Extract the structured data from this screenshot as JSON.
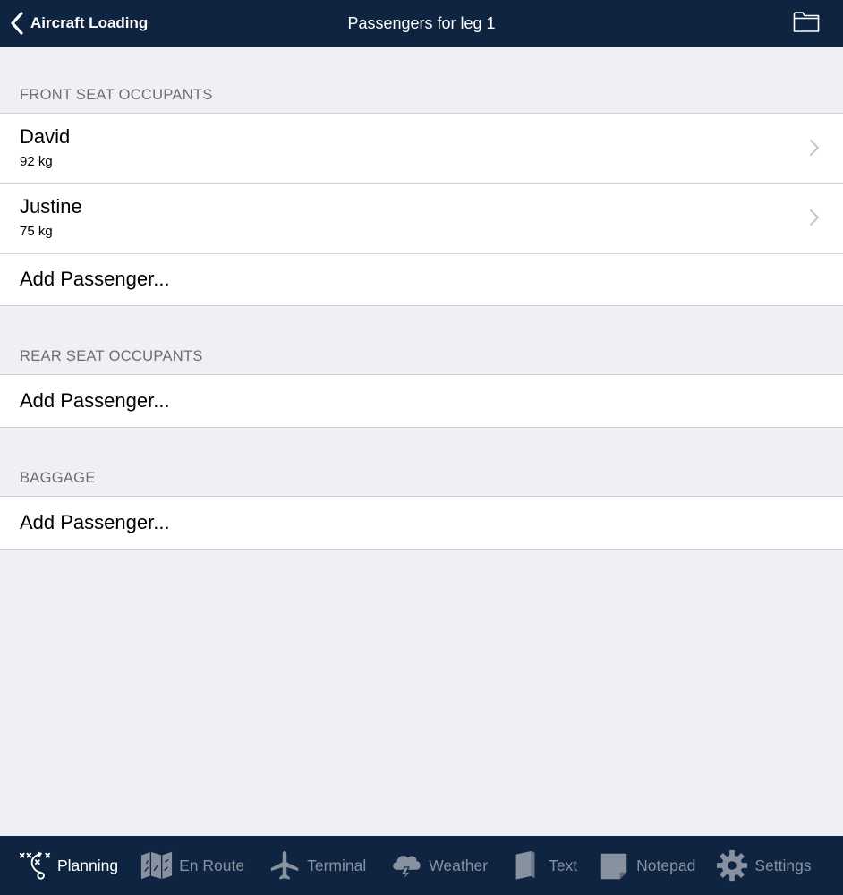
{
  "navbar": {
    "back_label": "Aircraft Loading",
    "title": "Passengers for leg 1"
  },
  "sections": {
    "front": {
      "header": "FRONT SEAT OCCUPANTS",
      "passengers": [
        {
          "name": "David",
          "weight": "92 kg"
        },
        {
          "name": "Justine",
          "weight": "75 kg"
        }
      ],
      "add_label": "Add Passenger..."
    },
    "rear": {
      "header": "REAR SEAT OCCUPANTS",
      "add_label": "Add Passenger..."
    },
    "baggage": {
      "header": "BAGGAGE",
      "add_label": "Add Passenger..."
    }
  },
  "tabbar": {
    "tabs": [
      {
        "label": "Planning",
        "icon": "planning-icon"
      },
      {
        "label": "En Route",
        "icon": "map-icon"
      },
      {
        "label": "Terminal",
        "icon": "airplane-icon"
      },
      {
        "label": "Weather",
        "icon": "cloud-lightning-icon"
      },
      {
        "label": "Text",
        "icon": "book-icon"
      },
      {
        "label": "Notepad",
        "icon": "notepad-icon"
      },
      {
        "label": "Settings",
        "icon": "gear-icon"
      }
    ],
    "active": "Planning"
  },
  "colors": {
    "bar_background": "#0f2440",
    "page_background": "#efeff4",
    "inactive_tab": "#8791a0"
  }
}
